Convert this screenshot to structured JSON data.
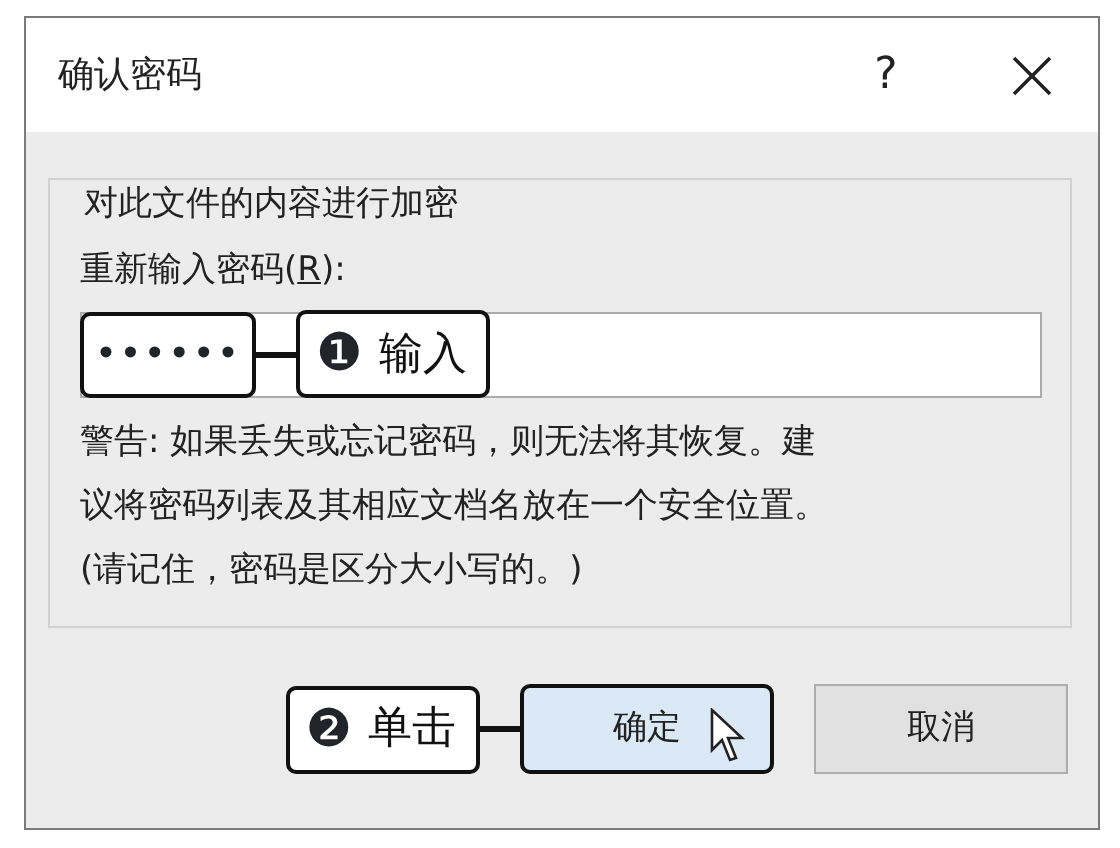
{
  "window": {
    "title": "确认密码",
    "help": "?"
  },
  "group": {
    "label": "对此文件的内容进行加密"
  },
  "field_label": {
    "before": "重新输入密码(",
    "access_key": "R",
    "after": "):"
  },
  "password": {
    "value": "••••••",
    "highlighted": true,
    "callout": {
      "number": "❶",
      "text": "输入"
    }
  },
  "warning_lines": [
    "警告: 如果丢失或忘记密码，则无法将其恢复。建",
    "议将密码列表及其相应文档名放在一个安全位置。",
    "(请记住，密码是区分大小写的。)"
  ],
  "buttons": [
    {
      "label": "确定",
      "default": true,
      "highlighted": true,
      "pointer": true,
      "callout": {
        "number": "❷",
        "text": "单击"
      }
    },
    {
      "label": "取消",
      "default": false,
      "highlighted": false,
      "pointer": false
    }
  ]
}
